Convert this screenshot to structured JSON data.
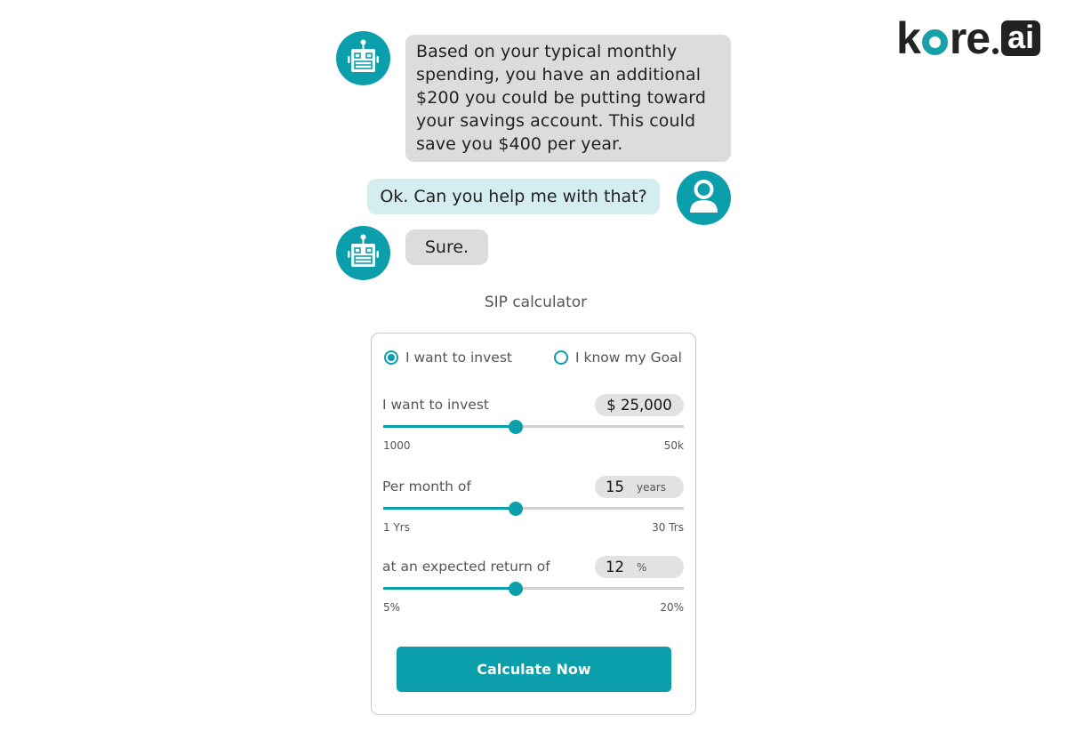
{
  "brand": {
    "logo_text_prefix": "k",
    "logo_text_suffix": "re",
    "logo_badge": "ai",
    "accent_color": "#0a9fab",
    "logo_ring_color": "#17a0aa"
  },
  "chat": {
    "messages": [
      {
        "sender": "bot",
        "avatar_icon": "robot-icon",
        "text": "Based on your typical monthly spending, you have an additional $200 you could be putting toward your savings account. This could save you $400 per year."
      },
      {
        "sender": "user",
        "avatar_icon": "user-icon",
        "text": "Ok. Can you help me with that?"
      },
      {
        "sender": "bot",
        "avatar_icon": "robot-icon",
        "text": "Sure."
      }
    ]
  },
  "calculator": {
    "title": "SIP calculator",
    "modes": [
      {
        "label": "I want to invest",
        "selected": true
      },
      {
        "label": "I know my Goal",
        "selected": false
      }
    ],
    "fields": [
      {
        "label": "I want to invest",
        "value": "$ 25,000",
        "unit": "",
        "min_label": "1000",
        "max_label": "50k",
        "min": 1000,
        "max": 50000,
        "current": 25000
      },
      {
        "label": "Per month of",
        "value": "15",
        "unit": "years",
        "min_label": "1 Yrs",
        "max_label": "30 Trs",
        "min": 1,
        "max": 30,
        "current": 15
      },
      {
        "label": "at an expected return of",
        "value": "12",
        "unit": "%",
        "min_label": "5%",
        "max_label": "20%",
        "min": 5,
        "max": 20,
        "current": 12
      }
    ],
    "submit_label": "Calculate Now"
  }
}
